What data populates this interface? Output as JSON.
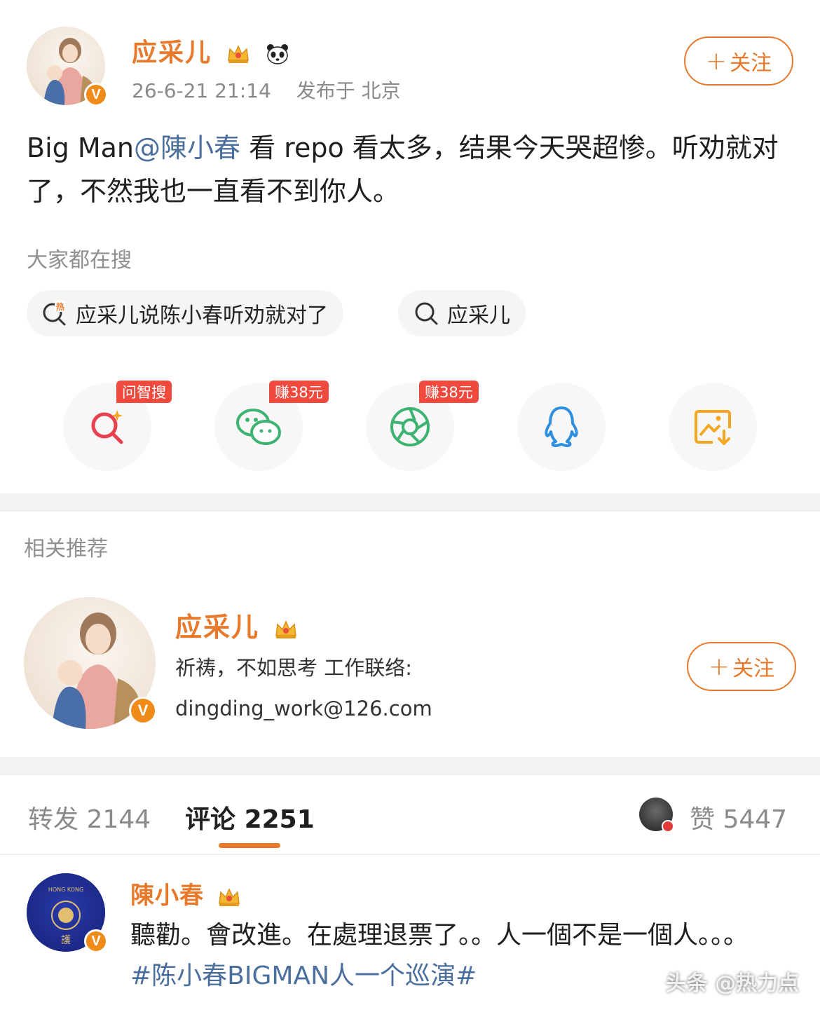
{
  "post": {
    "author_name": "应采儿",
    "timestamp": "26-6-21 21:14",
    "location": "发布于 北京",
    "follow_label": "关注",
    "text_prefix": "Big Man",
    "mention": "@陳小春",
    "text_body": " 看 repo 看太多，结果今天哭超惨。听劝就对了，不然我也一直看不到你人。",
    "author_badges": [
      "crown-icon",
      "panda-icon"
    ]
  },
  "search": {
    "title": "大家都在搜",
    "items": [
      {
        "label": "应采儿说陈小春听劝就对了",
        "icon": "hot-search-icon"
      },
      {
        "label": "应采儿",
        "icon": "search-icon"
      }
    ]
  },
  "share": {
    "items": [
      {
        "icon": "ai-search-icon",
        "tag": "问智搜"
      },
      {
        "icon": "wechat-icon",
        "tag": "赚38元"
      },
      {
        "icon": "moments-icon",
        "tag": "赚38元"
      },
      {
        "icon": "qq-icon",
        "tag": ""
      },
      {
        "icon": "save-image-icon",
        "tag": ""
      }
    ]
  },
  "recommend": {
    "title": "相关推荐",
    "name": "应采儿",
    "desc_line1": "祈祷，不如思考 工作联络:",
    "desc_line2": "dingding_work@126.com",
    "follow_label": "关注"
  },
  "tabs": {
    "repost_label": "转发",
    "repost_count": "2144",
    "comment_label": "评论",
    "comment_count": "2251",
    "like_label": "赞",
    "like_count": "5447"
  },
  "comment": {
    "name": "陳小春",
    "text_main": "聽勸。會改進。在處理退票了。。人一個不是一個人。。。",
    "hashtag": "#陈小春BIGMAN人一个巡演#"
  },
  "watermark": "头条 @热力点"
}
